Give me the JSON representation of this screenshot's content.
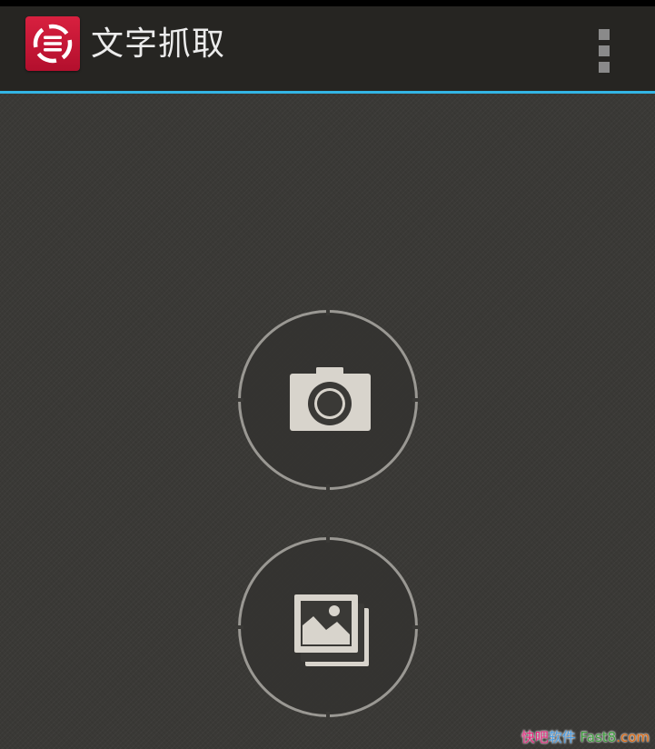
{
  "app": {
    "title": "文字抓取",
    "icon": "text-capture-app-icon"
  },
  "actions": {
    "camera": {
      "icon": "camera-icon"
    },
    "gallery": {
      "icon": "gallery-icon"
    }
  },
  "menu": {
    "icon": "overflow-menu-icon"
  },
  "colors": {
    "accent_divider": "#33b5e5",
    "app_icon_red": "#d8203f",
    "action_bar": "#262522",
    "background": "#3a3936",
    "icon_fill": "#d8d4cc",
    "ring": "#9a9893"
  },
  "watermark": {
    "part1": "快吧",
    "part2": "软件",
    "part3": " Fast8",
    "part4": ".com"
  }
}
